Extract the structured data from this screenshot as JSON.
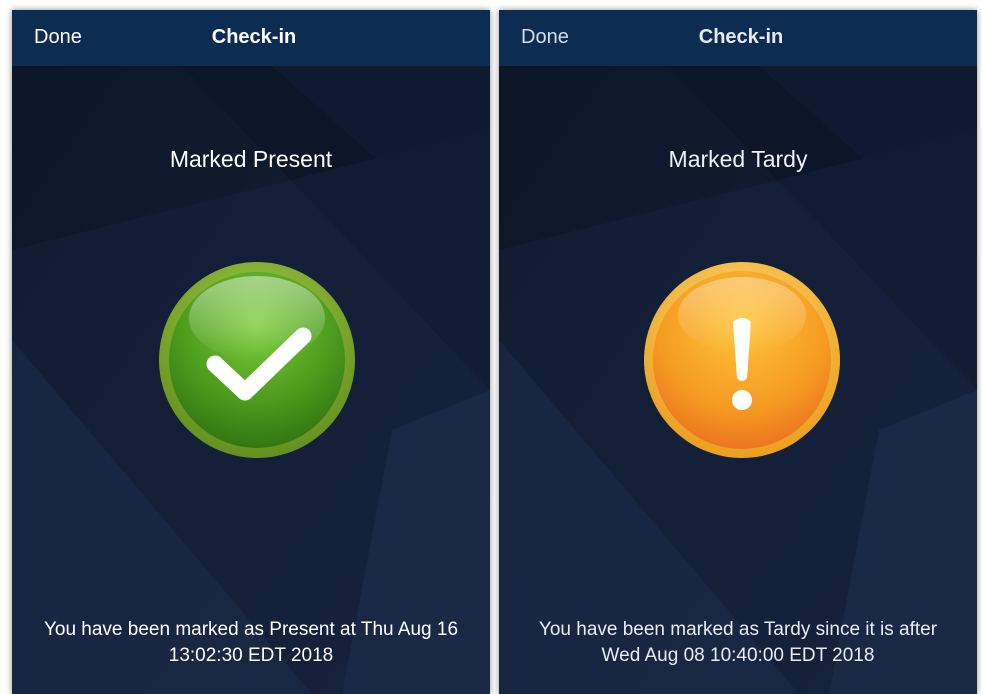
{
  "screens": [
    {
      "nav": {
        "done_label": "Done",
        "title": "Check-in"
      },
      "status_title": "Marked Present",
      "status_icon": "checkmark-icon",
      "message": "You have been marked as Present at Thu Aug 16 13:02:30 EDT 2018",
      "colors": {
        "icon_ring": "#6f9a25",
        "icon_fill": "#4a9a1c",
        "navbar": "#0d2c52"
      }
    },
    {
      "nav": {
        "done_label": "Done",
        "title": "Check-in"
      },
      "status_title": "Marked Tardy",
      "status_icon": "exclamation-icon",
      "message": "You have been marked as Tardy since it is after Wed Aug 08 10:40:00 EDT 2018",
      "colors": {
        "icon_ring": "#f0b020",
        "icon_fill": "#ee8a22",
        "navbar": "#0d2c52"
      }
    }
  ]
}
